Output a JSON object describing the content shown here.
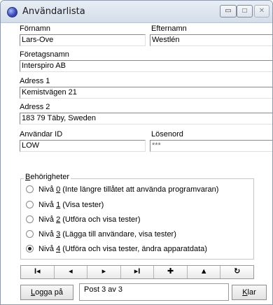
{
  "window": {
    "title": "Användarlista",
    "minimize_glyph": "▭",
    "maximize_glyph": "□",
    "close_glyph": "✕"
  },
  "form": {
    "firstname": {
      "label": "Förnamn",
      "value": "Lars-Ove"
    },
    "lastname": {
      "label": "Efternamn",
      "value": "Westlén"
    },
    "company": {
      "label": "Företagsnamn",
      "value": "Interspiro AB"
    },
    "address1": {
      "label": "Adress 1",
      "value": "Kemistvägen 21"
    },
    "address2": {
      "label": "Adress 2",
      "value": "183 79 Täby, Sweden"
    },
    "user_id": {
      "label": "Användar ID",
      "value": "LOW"
    },
    "password": {
      "label": "Lösenord",
      "value": "***"
    }
  },
  "permissions": {
    "legend_prefix": "",
    "legend_underlined": "B",
    "legend_rest": "ehörigheter",
    "options": [
      {
        "prefix": "Nivå ",
        "key": "0",
        "rest": " (Inte längre tillåtet att använda programvaran)",
        "checked": false
      },
      {
        "prefix": "Nivå ",
        "key": "1",
        "rest": " (Visa tester)",
        "checked": false
      },
      {
        "prefix": "Nivå ",
        "key": "2",
        "rest": " (Utföra och visa tester)",
        "checked": false
      },
      {
        "prefix": "Nivå ",
        "key": "3",
        "rest": " (Lägga till användare, visa tester)",
        "checked": false
      },
      {
        "prefix": "Nivå ",
        "key": "4",
        "rest": " (Utföra och visa tester, ändra apparatdata)",
        "checked": true
      }
    ]
  },
  "navigation": {
    "first": "I◂",
    "prev": "◂",
    "next": "▸",
    "last": "▸I",
    "add": "✚",
    "up": "▲",
    "refresh": "↻"
  },
  "footer": {
    "login_underlined": "L",
    "login_rest": "ogga på",
    "status": "Post 3 av 3",
    "done_underlined": "K",
    "done_rest": "lar"
  }
}
